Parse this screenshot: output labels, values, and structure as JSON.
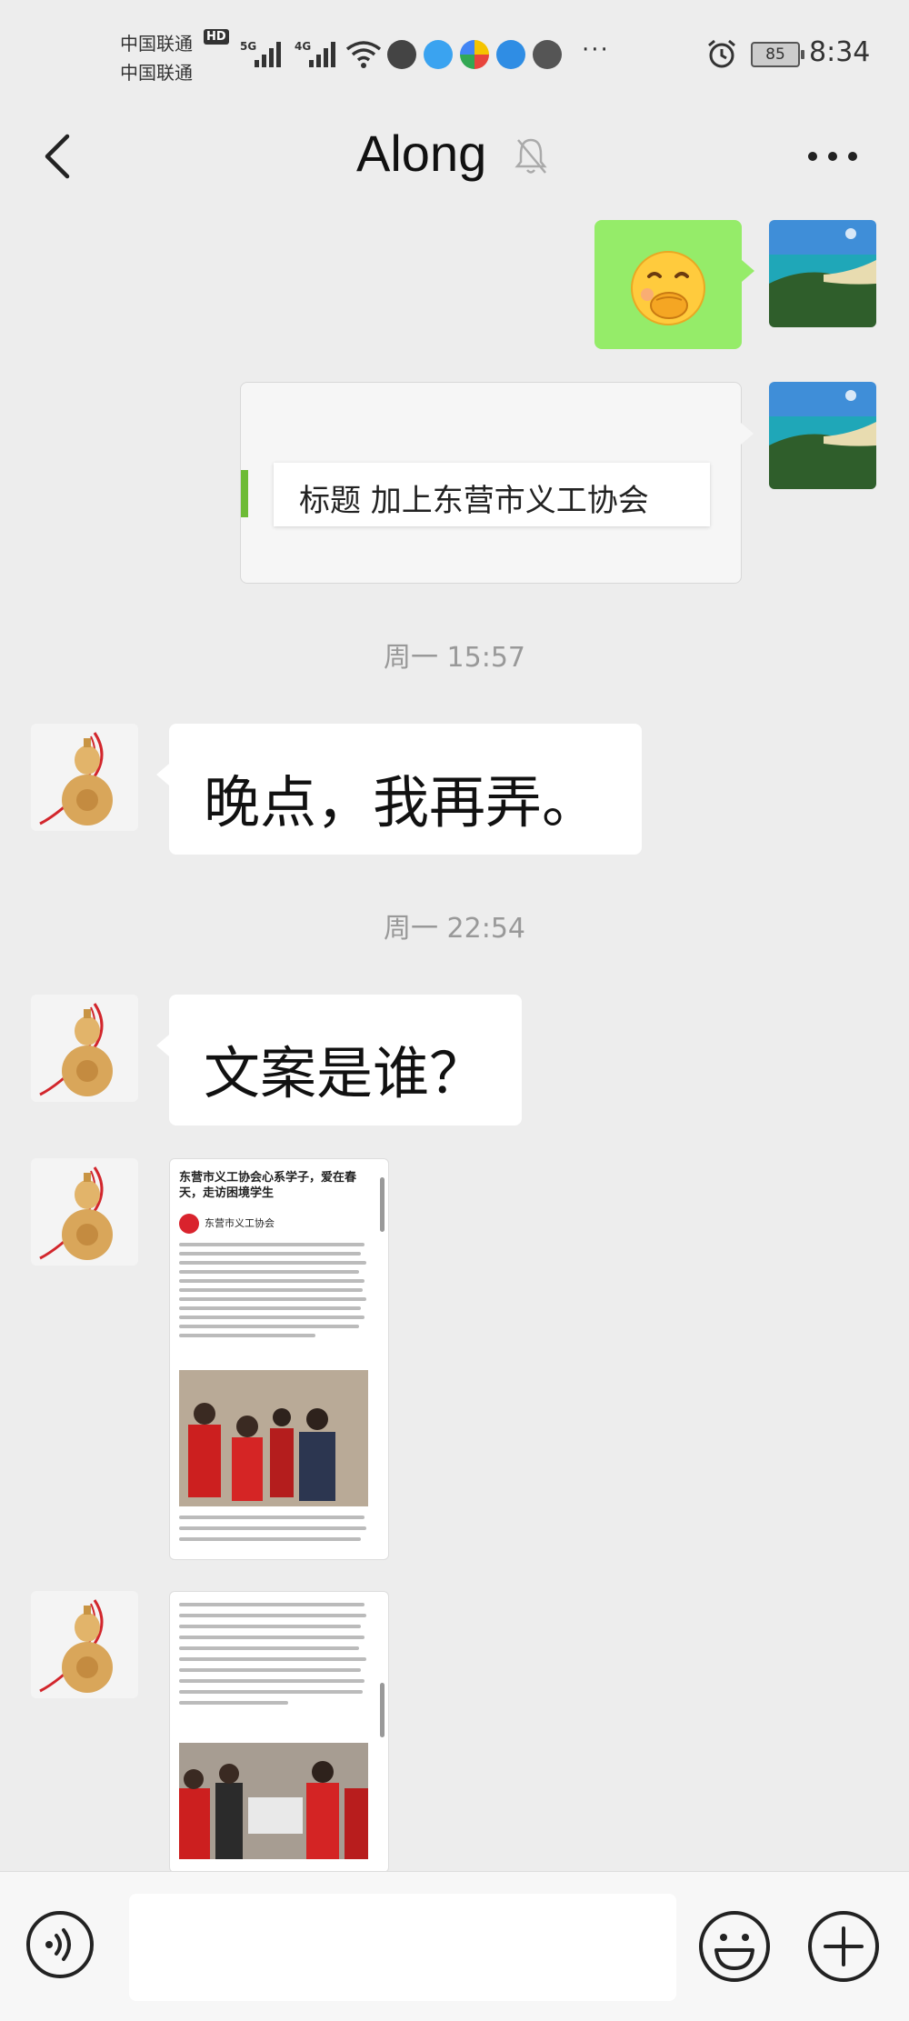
{
  "status_bar": {
    "carrier1": "中国联通",
    "carrier2": "中国联通",
    "hd_badge": "HD",
    "net1": "5G",
    "net2": "4G",
    "more": "···",
    "battery": "85",
    "time": "8:34"
  },
  "nav": {
    "title": "Along",
    "muted": true
  },
  "messages": [
    {
      "type": "emoji",
      "sender": "self",
      "emoji": "face-with-hand-over-mouth"
    },
    {
      "type": "link",
      "sender": "self",
      "text": "标题 加上东营市义工协会"
    },
    {
      "type": "timestamp",
      "text": "周一 15:57"
    },
    {
      "type": "text",
      "sender": "friend",
      "text": "晚点，我再弄。"
    },
    {
      "type": "timestamp",
      "text": "周一 22:54"
    },
    {
      "type": "text",
      "sender": "friend",
      "text": "文案是谁？"
    },
    {
      "type": "image",
      "sender": "friend",
      "doc_title": "东营市义工协会心系学子，爱在春天，走访困境学生",
      "org": "东营市义工协会"
    },
    {
      "type": "image",
      "sender": "friend"
    }
  ],
  "input_bar": {
    "voice_icon": "voice-icon",
    "emoji_icon": "emoji-icon",
    "plus_icon": "plus-icon",
    "message_value": ""
  },
  "colors": {
    "background": "#ededed",
    "self_bubble": "#95ec69",
    "friend_bubble": "#ffffff",
    "timestamp": "#999999"
  }
}
